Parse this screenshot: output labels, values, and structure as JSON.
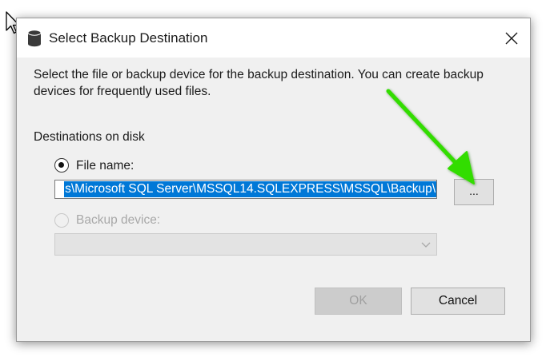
{
  "dialog": {
    "title": "Select Backup Destination",
    "title_icon": "database-icon",
    "close_icon": "close-icon"
  },
  "description": "Select the file or backup device for the backup destination. You can create backup devices for frequently used files.",
  "destinations": {
    "label": "Destinations on disk",
    "file_name": {
      "label": "File name:",
      "selected": true,
      "value": "s\\Microsoft SQL Server\\MSSQL14.SQLEXPRESS\\MSSQL\\Backup\\"
    },
    "browse_label": "...",
    "backup_device": {
      "label": "Backup device:",
      "selected": false,
      "enabled": false,
      "value": ""
    }
  },
  "buttons": {
    "ok": "OK",
    "cancel": "Cancel"
  },
  "colors": {
    "selection": "#0078d7",
    "annotation_arrow": "#33dd00",
    "dialog_bg": "#f0f0f0"
  },
  "annotation": {
    "type": "arrow",
    "points_to": "browse-button"
  }
}
